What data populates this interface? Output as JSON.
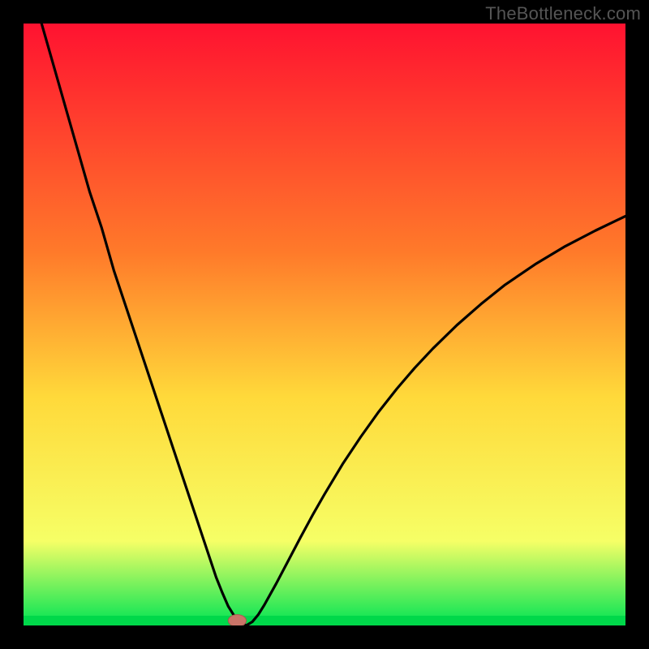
{
  "watermark": "TheBottleneck.com",
  "colors": {
    "background": "#000000",
    "gradient_top": "#ff1230",
    "gradient_mid_upper": "#ff7a2a",
    "gradient_mid": "#ffd93a",
    "gradient_lower": "#f6ff66",
    "gradient_bottom": "#00e454",
    "green_band": "#00d84a",
    "curve": "#000000",
    "marker_fill": "#c97468",
    "marker_stroke": "#a85a4f"
  },
  "chart_data": {
    "type": "line",
    "title": "",
    "xlabel": "",
    "ylabel": "",
    "xlim": [
      0,
      100
    ],
    "ylim": [
      0,
      100
    ],
    "grid": false,
    "legend": false,
    "x": [
      3,
      5,
      7,
      9,
      11,
      13,
      15,
      17,
      19,
      21,
      23,
      25,
      27,
      29,
      30,
      31,
      32,
      33,
      34,
      35,
      36,
      37,
      38,
      39,
      40,
      42,
      44,
      46,
      48,
      50,
      53,
      56,
      59,
      62,
      65,
      68,
      72,
      76,
      80,
      85,
      90,
      95,
      100
    ],
    "y": [
      100,
      93,
      86,
      79,
      72,
      66,
      59,
      53,
      47,
      41,
      35,
      29,
      23,
      17,
      14,
      11,
      8,
      5.5,
      3.2,
      1.6,
      0.6,
      0.0,
      0.6,
      1.8,
      3.4,
      7.0,
      10.8,
      14.6,
      18.3,
      21.8,
      26.8,
      31.3,
      35.5,
      39.3,
      42.8,
      46.0,
      49.9,
      53.4,
      56.6,
      60.0,
      63.0,
      65.6,
      68.0
    ],
    "series": [
      {
        "name": "bottleneck_curve",
        "x_key": "x",
        "y_key": "y"
      }
    ],
    "marker": {
      "x": 35.5,
      "y": 0.8,
      "rx": 1.5,
      "ry": 1.0
    }
  }
}
